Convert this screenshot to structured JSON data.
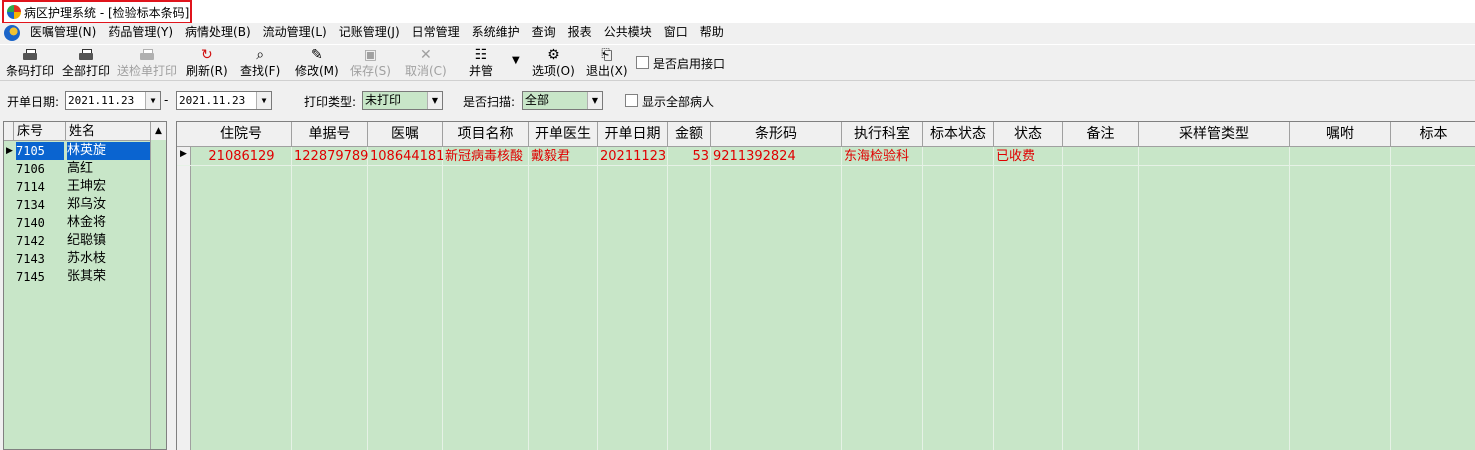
{
  "window": {
    "title": "病区护理系统 - [检验标本条码]"
  },
  "menu": [
    "医嘱管理(N)",
    "药品管理(Y)",
    "病情处理(B)",
    "流动管理(L)",
    "记账管理(J)",
    "日常管理",
    "系统维护",
    "查询",
    "报表",
    "公共模块",
    "窗口",
    "帮助"
  ],
  "toolbar": {
    "barcode_print": "条码打印",
    "print_all": "全部打印",
    "send_print": "送检单打印",
    "refresh": "刷新(R)",
    "find": "查找(F)",
    "modify": "修改(M)",
    "save": "保存(S)",
    "cancel": "取消(C)",
    "merge": "并管",
    "options": "选项(O)",
    "exit": "退出(X)",
    "enable_interface": "是否启用接口"
  },
  "filters": {
    "date_label": "开单日期:",
    "date_from": "2021.11.23",
    "date_sep": "-",
    "date_to": "2021.11.23",
    "print_type_label": "打印类型:",
    "print_type": "未打印",
    "scan_label": "是否扫描:",
    "scan": "全部",
    "show_all_label": "显示全部病人"
  },
  "patients": {
    "headers": [
      "床号",
      "姓名"
    ],
    "rows": [
      {
        "bed": "7105",
        "name": "林英旋"
      },
      {
        "bed": "7106",
        "name": "高红"
      },
      {
        "bed": "7114",
        "name": "王坤宏"
      },
      {
        "bed": "7134",
        "name": "郑乌汝"
      },
      {
        "bed": "7140",
        "name": "林金将"
      },
      {
        "bed": "7142",
        "name": "纪聪镇"
      },
      {
        "bed": "7143",
        "name": "苏水枝"
      },
      {
        "bed": "7145",
        "name": "张其荣"
      }
    ]
  },
  "grid": {
    "headers": [
      "住院号",
      "单据号",
      "医嘱",
      "项目名称",
      "开单医生",
      "开单日期",
      "金额",
      "条形码",
      "执行科室",
      "标本状态",
      "状态",
      "备注",
      "采样管类型",
      "嘱咐",
      "标本"
    ],
    "rows": [
      [
        "21086129",
        "122879789",
        "108644181",
        "新冠病毒核酸",
        "戴毅君",
        "20211123",
        "53",
        "9211392824",
        "东海检验科",
        "",
        "已收费",
        "",
        "",
        "",
        ""
      ]
    ]
  },
  "colors": {
    "grid_bg": "#c8e6c8",
    "row_text": "#e00000",
    "selection": "#0a64d0",
    "highlight_border": "#e0141c"
  }
}
